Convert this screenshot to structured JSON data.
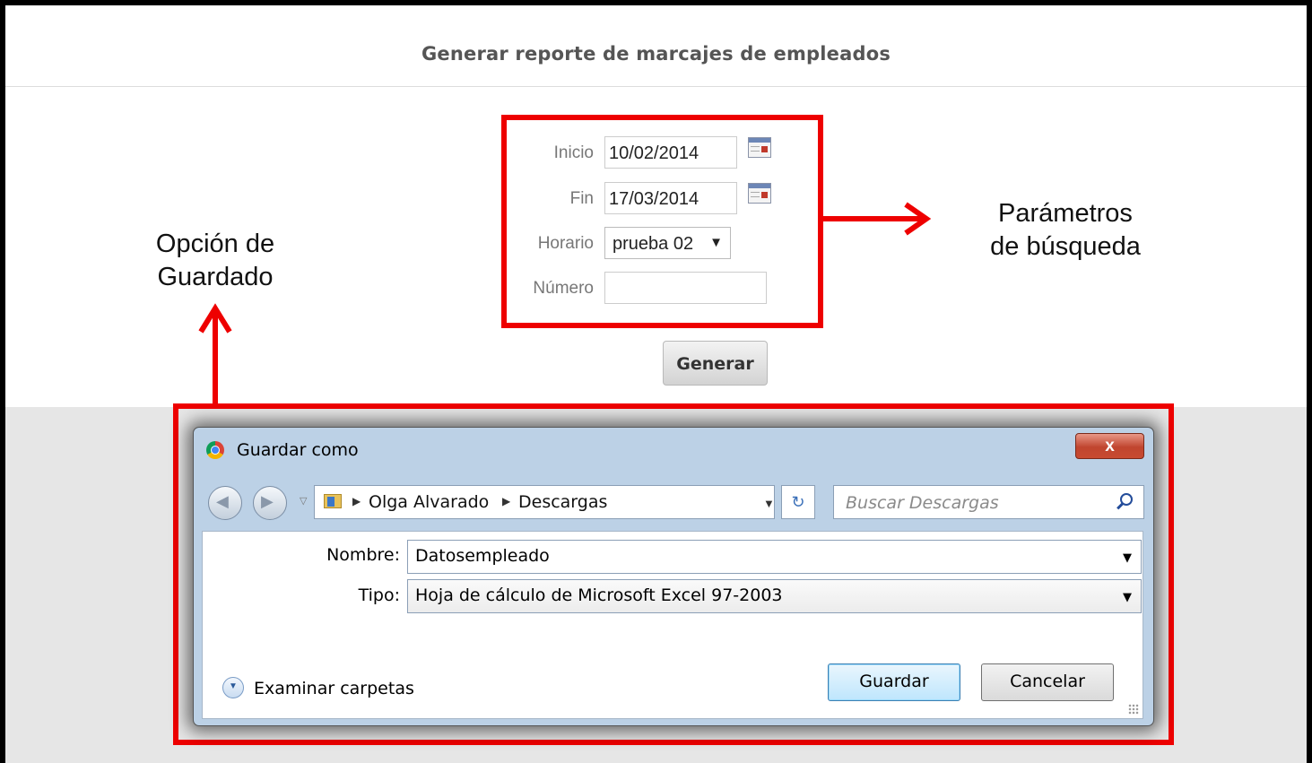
{
  "page": {
    "header_title": "Generar reporte de marcajes de empleados"
  },
  "form": {
    "inicio_label": "Inicio",
    "inicio_value": "10/02/2014",
    "fin_label": "Fin",
    "fin_value": "17/03/2014",
    "horario_label": "Horario",
    "horario_value": "prueba 02",
    "numero_label": "Número",
    "numero_value": "",
    "generate_button": "Generar"
  },
  "annotations": {
    "params_line1": "Parámetros",
    "params_line2": "de búsqueda",
    "save_line1": "Opción de",
    "save_line2": "Guardado",
    "color": "#ee0000"
  },
  "save_dialog": {
    "title": "Guardar como",
    "close_label": "x",
    "path": [
      "Olga Alvarado",
      "Descargas"
    ],
    "search_placeholder": "Buscar Descargas",
    "name_label": "Nombre:",
    "name_value": "Datosempleado",
    "type_label": "Tipo:",
    "type_value": "Hoja de cálculo de Microsoft Excel 97-2003",
    "browse_folders": "Examinar carpetas",
    "save_button": "Guardar",
    "cancel_button": "Cancelar"
  }
}
